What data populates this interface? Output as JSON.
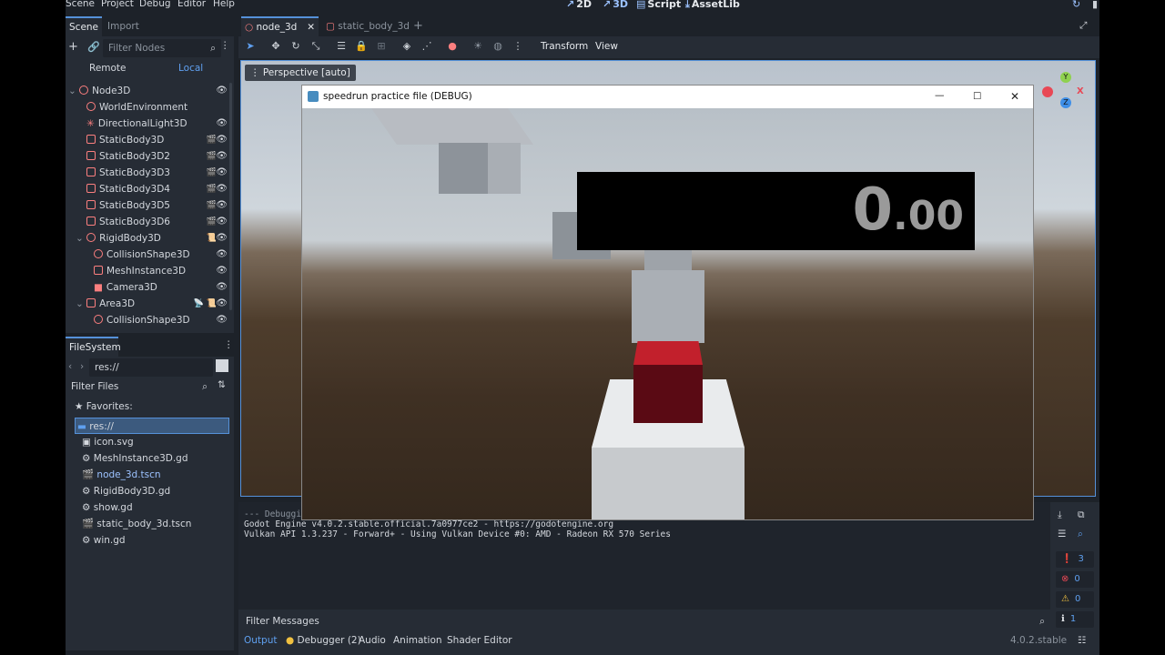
{
  "menu": [
    "Scene",
    "Project",
    "Debug",
    "Editor",
    "Help"
  ],
  "main_buttons": [
    {
      "icon": "2D",
      "label": "2D"
    },
    {
      "icon": "3D",
      "label": "3D"
    },
    {
      "icon": "script-icon",
      "label": "Script"
    },
    {
      "icon": "assetlib-icon",
      "label": "AssetLib"
    }
  ],
  "scene_dock": {
    "tabs": [
      "Scene",
      "Import"
    ],
    "filter_placeholder": "Filter Nodes",
    "remote": "Remote",
    "local": "Local",
    "nodes": [
      {
        "name": "Node3D",
        "extra": ""
      },
      {
        "name": "WorldEnvironment",
        "extra": ""
      },
      {
        "name": "DirectionalLight3D",
        "extra": ""
      },
      {
        "name": "StaticBody3D",
        "extra": "🎬"
      },
      {
        "name": "StaticBody3D2",
        "extra": "🎬"
      },
      {
        "name": "StaticBody3D3",
        "extra": "🎬"
      },
      {
        "name": "StaticBody3D4",
        "extra": "🎬"
      },
      {
        "name": "StaticBody3D5",
        "extra": "🎬"
      },
      {
        "name": "StaticBody3D6",
        "extra": "🎬"
      },
      {
        "name": "RigidBody3D",
        "extra": "📜"
      },
      {
        "name": "CollisionShape3D",
        "extra": ""
      },
      {
        "name": "MeshInstance3D",
        "extra": ""
      },
      {
        "name": "Camera3D",
        "extra": ""
      },
      {
        "name": "Area3D",
        "extra": "📡 📜"
      },
      {
        "name": "CollisionShape3D",
        "extra": ""
      }
    ]
  },
  "filesystem": {
    "tab": "FileSystem",
    "path": "res://",
    "filter_placeholder": "Filter Files",
    "favorites": "Favorites:",
    "items": [
      {
        "name": "res://",
        "selected": true
      },
      {
        "name": "icon.svg",
        "selected": false
      },
      {
        "name": "MeshInstance3D.gd",
        "selected": false
      },
      {
        "name": "node_3d.tscn",
        "selected": false
      },
      {
        "name": "RigidBody3D.gd",
        "selected": false
      },
      {
        "name": "show.gd",
        "selected": false
      },
      {
        "name": "static_body_3d.tscn",
        "selected": false
      },
      {
        "name": "win.gd",
        "selected": false
      }
    ]
  },
  "scene_tabs": [
    "node_3d",
    "static_body_3d"
  ],
  "toolbar": {
    "transform": "Transform",
    "view": "View"
  },
  "viewport": {
    "label": "Perspective [auto]"
  },
  "game_window": {
    "title": "speedrun practice file (DEBUG)",
    "timer_int": "0",
    "timer_dec": ".00"
  },
  "output": {
    "lines": [
      "--- Debugging",
      "Godot Engine v4.0.2.stable.official.7a0977ce2 - https://godotengine.org",
      "Vulkan API 1.3.237 - Forward+ - Using Vulkan Device #0: AMD - Radeon RX 570 Series"
    ],
    "filter_placeholder": "Filter Messages",
    "counters": [
      "3",
      "0",
      "0",
      "1"
    ],
    "tabs": [
      "Output",
      "Debugger (2)",
      "Audio",
      "Animation",
      "Shader Editor"
    ],
    "version": "4.0.2.stable"
  }
}
